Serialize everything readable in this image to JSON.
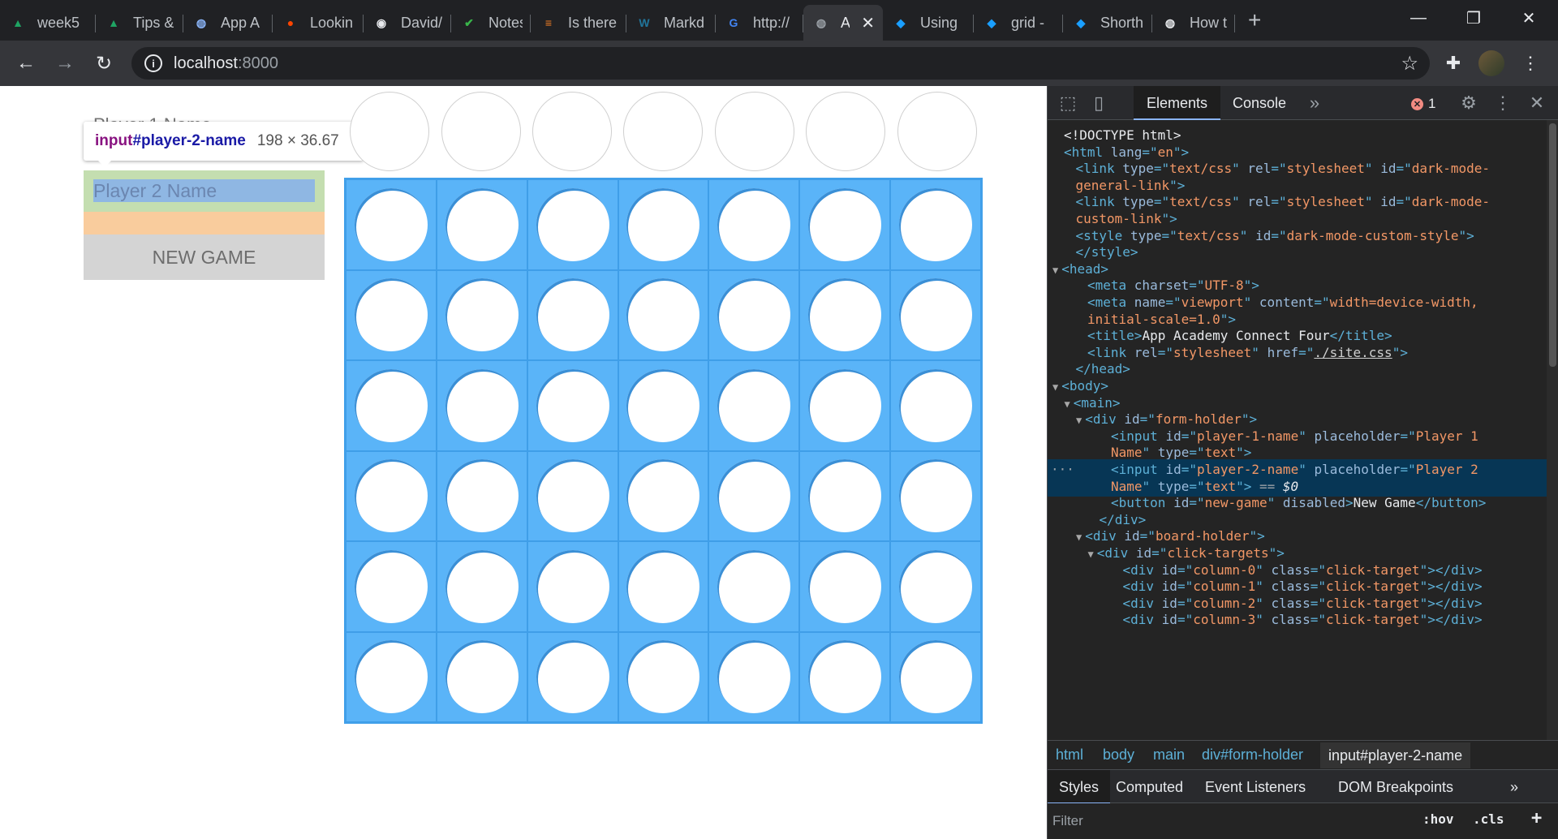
{
  "browser": {
    "tabs": [
      {
        "title": "week5",
        "icon": "google-drive-icon",
        "color": "#1fa463"
      },
      {
        "title": "Tips &",
        "icon": "google-drive-icon",
        "color": "#1fa463"
      },
      {
        "title": "App A",
        "icon": "globe-icon",
        "color": "#8ab4f8"
      },
      {
        "title": "Lookin",
        "icon": "reddit-icon",
        "color": "#ff4500"
      },
      {
        "title": "David/",
        "icon": "github-icon",
        "color": "#e8eaed"
      },
      {
        "title": "Notes",
        "icon": "notes-icon",
        "color": "#39b54a"
      },
      {
        "title": "Is there",
        "icon": "stackoverflow-icon",
        "color": "#f48024"
      },
      {
        "title": "Markd",
        "icon": "wordpress-icon",
        "color": "#21759b"
      },
      {
        "title": "http://",
        "icon": "google-icon",
        "color": "#4285f4"
      },
      {
        "title": "Ap",
        "icon": "globe-icon",
        "color": "#9aa0a6",
        "active": true
      },
      {
        "title": "Using",
        "icon": "kite-icon",
        "color": "#1a9fff"
      },
      {
        "title": "grid -",
        "icon": "kite-icon",
        "color": "#1a9fff"
      },
      {
        "title": "Shorth",
        "icon": "kite-icon",
        "color": "#1a9fff"
      },
      {
        "title": "How t",
        "icon": "globe-icon",
        "color": "#e8eaed"
      }
    ],
    "url_host": "localhost",
    "url_port": ":8000"
  },
  "page": {
    "player1_placeholder": "Player 1 Name",
    "player2_placeholder": "Player 2 Name",
    "new_game_label": "NEW GAME",
    "tooltip": {
      "tag": "input",
      "id": "#player-2-name",
      "dims": "198 × 36.67"
    },
    "board": {
      "columns": 7,
      "rows": 6,
      "board_color": "#5ab4f8"
    }
  },
  "devtools": {
    "tabs": {
      "elements": "Elements",
      "console": "Console"
    },
    "error_count": "1",
    "dom_lines": [
      {
        "indent": 0,
        "arrow": "",
        "html": "<span class='tx'>&lt;!DOCTYPE html&gt;</span>"
      },
      {
        "indent": 0,
        "arrow": "",
        "html": "<span class='t'>&lt;html </span><span class='an'>lang</span><span class='t'>=\"</span><span class='av'>en</span><span class='t'>\"&gt;</span>"
      },
      {
        "indent": 1,
        "arrow": "",
        "html": "<span class='t'>&lt;link </span><span class='an'>type</span><span class='t'>=\"</span><span class='av'>text/css</span><span class='t'>\" </span><span class='an'>rel</span><span class='t'>=\"</span><span class='av'>stylesheet</span><span class='t'>\" </span><span class='an'>id</span><span class='t'>=\"</span><span class='av'>dark-mode-</span>"
      },
      {
        "indent": 1,
        "arrow": "",
        "html": "<span class='av'>general-link</span><span class='t'>\"&gt;</span>"
      },
      {
        "indent": 1,
        "arrow": "",
        "html": "<span class='t'>&lt;link </span><span class='an'>type</span><span class='t'>=\"</span><span class='av'>text/css</span><span class='t'>\" </span><span class='an'>rel</span><span class='t'>=\"</span><span class='av'>stylesheet</span><span class='t'>\" </span><span class='an'>id</span><span class='t'>=\"</span><span class='av'>dark-mode-</span>"
      },
      {
        "indent": 1,
        "arrow": "",
        "html": "<span class='av'>custom-link</span><span class='t'>\"&gt;</span>"
      },
      {
        "indent": 1,
        "arrow": "",
        "html": "<span class='t'>&lt;style </span><span class='an'>type</span><span class='t'>=\"</span><span class='av'>text/css</span><span class='t'>\" </span><span class='an'>id</span><span class='t'>=\"</span><span class='av'>dark-mode-custom-style</span><span class='t'>\"&gt;</span>"
      },
      {
        "indent": 1,
        "arrow": "",
        "html": "<span class='t'>&lt;/style&gt;</span>"
      },
      {
        "indent": 0,
        "arrow": "▼",
        "html": "<span class='t'>&lt;head&gt;</span>"
      },
      {
        "indent": 2,
        "arrow": "",
        "html": "<span class='t'>&lt;meta </span><span class='an'>charset</span><span class='t'>=\"</span><span class='av'>UTF-8</span><span class='t'>\"&gt;</span>"
      },
      {
        "indent": 2,
        "arrow": "",
        "html": "<span class='t'>&lt;meta </span><span class='an'>name</span><span class='t'>=\"</span><span class='av'>viewport</span><span class='t'>\" </span><span class='an'>content</span><span class='t'>=\"</span><span class='av'>width=device-width,</span>"
      },
      {
        "indent": 2,
        "arrow": "",
        "html": "<span class='av'>initial-scale=1.0</span><span class='t'>\"&gt;</span>"
      },
      {
        "indent": 2,
        "arrow": "",
        "html": "<span class='t'>&lt;title&gt;</span><span class='tx'>App Academy Connect Four</span><span class='t'>&lt;/title&gt;</span>"
      },
      {
        "indent": 2,
        "arrow": "",
        "html": "<span class='t'>&lt;link </span><span class='an'>rel</span><span class='t'>=\"</span><span class='av'>stylesheet</span><span class='t'>\" </span><span class='an'>href</span><span class='t'>=\"</span><span class='lnk'>./site.css</span><span class='t'>\"&gt;</span>"
      },
      {
        "indent": 1,
        "arrow": "",
        "html": "<span class='t'>&lt;/head&gt;</span>"
      },
      {
        "indent": 0,
        "arrow": "▼",
        "html": "<span class='t'>&lt;body&gt;</span>"
      },
      {
        "indent": 1,
        "arrow": "▼",
        "html": "<span class='t'>&lt;main&gt;</span>"
      },
      {
        "indent": 2,
        "arrow": "▼",
        "html": "<span class='t'>&lt;div </span><span class='an'>id</span><span class='t'>=\"</span><span class='av'>form-holder</span><span class='t'>\"&gt;</span>"
      },
      {
        "indent": 4,
        "arrow": "",
        "html": "<span class='t'>&lt;input </span><span class='an'>id</span><span class='t'>=\"</span><span class='av'>player-1-name</span><span class='t'>\" </span><span class='an'>placeholder</span><span class='t'>=\"</span><span class='av'>Player 1</span>"
      },
      {
        "indent": 4,
        "arrow": "",
        "html": "<span class='av'>Name</span><span class='t'>\" </span><span class='an'>type</span><span class='t'>=\"</span><span class='av'>text</span><span class='t'>\"&gt;</span>"
      },
      {
        "indent": 4,
        "arrow": "",
        "selected": true,
        "html": "<span class='t'>&lt;input </span><span class='an'>id</span><span class='t'>=\"</span><span class='av'>player-2-name</span><span class='t'>\" </span><span class='an'>placeholder</span><span class='t'>=\"</span><span class='av'>Player 2</span>"
      },
      {
        "indent": 4,
        "arrow": "",
        "selected": true,
        "html": "<span class='av'>Name</span><span class='t'>\" </span><span class='an'>type</span><span class='t'>=\"</span><span class='av'>text</span><span class='t'>\"&gt;</span><span class='cm'> == </span><span class='tx'><i>$0</i></span>"
      },
      {
        "indent": 4,
        "arrow": "",
        "html": "<span class='t'>&lt;button </span><span class='an'>id</span><span class='t'>=\"</span><span class='av'>new-game</span><span class='t'>\" </span><span class='an'>disabled</span><span class='t'>&gt;</span><span class='tx'>New Game</span><span class='t'>&lt;/button&gt;</span>"
      },
      {
        "indent": 3,
        "arrow": "",
        "html": "<span class='t'>&lt;/div&gt;</span>"
      },
      {
        "indent": 2,
        "arrow": "▼",
        "html": "<span class='t'>&lt;div </span><span class='an'>id</span><span class='t'>=\"</span><span class='av'>board-holder</span><span class='t'>\"&gt;</span>"
      },
      {
        "indent": 3,
        "arrow": "▼",
        "html": "<span class='t'>&lt;div </span><span class='an'>id</span><span class='t'>=\"</span><span class='av'>click-targets</span><span class='t'>\"&gt;</span>"
      },
      {
        "indent": 5,
        "arrow": "",
        "html": "<span class='t'>&lt;div </span><span class='an'>id</span><span class='t'>=\"</span><span class='av'>column-0</span><span class='t'>\" </span><span class='an'>class</span><span class='t'>=\"</span><span class='av'>click-target</span><span class='t'>\"&gt;&lt;/div&gt;</span>"
      },
      {
        "indent": 5,
        "arrow": "",
        "html": "<span class='t'>&lt;div </span><span class='an'>id</span><span class='t'>=\"</span><span class='av'>column-1</span><span class='t'>\" </span><span class='an'>class</span><span class='t'>=\"</span><span class='av'>click-target</span><span class='t'>\"&gt;&lt;/div&gt;</span>"
      },
      {
        "indent": 5,
        "arrow": "",
        "html": "<span class='t'>&lt;div </span><span class='an'>id</span><span class='t'>=\"</span><span class='av'>column-2</span><span class='t'>\" </span><span class='an'>class</span><span class='t'>=\"</span><span class='av'>click-target</span><span class='t'>\"&gt;&lt;/div&gt;</span>"
      },
      {
        "indent": 5,
        "arrow": "",
        "html": "<span class='t'>&lt;div </span><span class='an'>id</span><span class='t'>=\"</span><span class='av'>column-3</span><span class='t'>\" </span><span class='an'>class</span><span class='t'>=\"</span><span class='av'>click-target</span><span class='t'>\"&gt;&lt;/div&gt;</span>"
      }
    ],
    "crumbs": [
      "html",
      "body",
      "main",
      "div#form-holder"
    ],
    "current_crumb": "input#player-2-name",
    "subtabs": [
      "Styles",
      "Computed",
      "Event Listeners",
      "DOM Breakpoints"
    ],
    "filter_placeholder": "Filter",
    "hov_label": ":hov",
    "cls_label": ".cls"
  }
}
